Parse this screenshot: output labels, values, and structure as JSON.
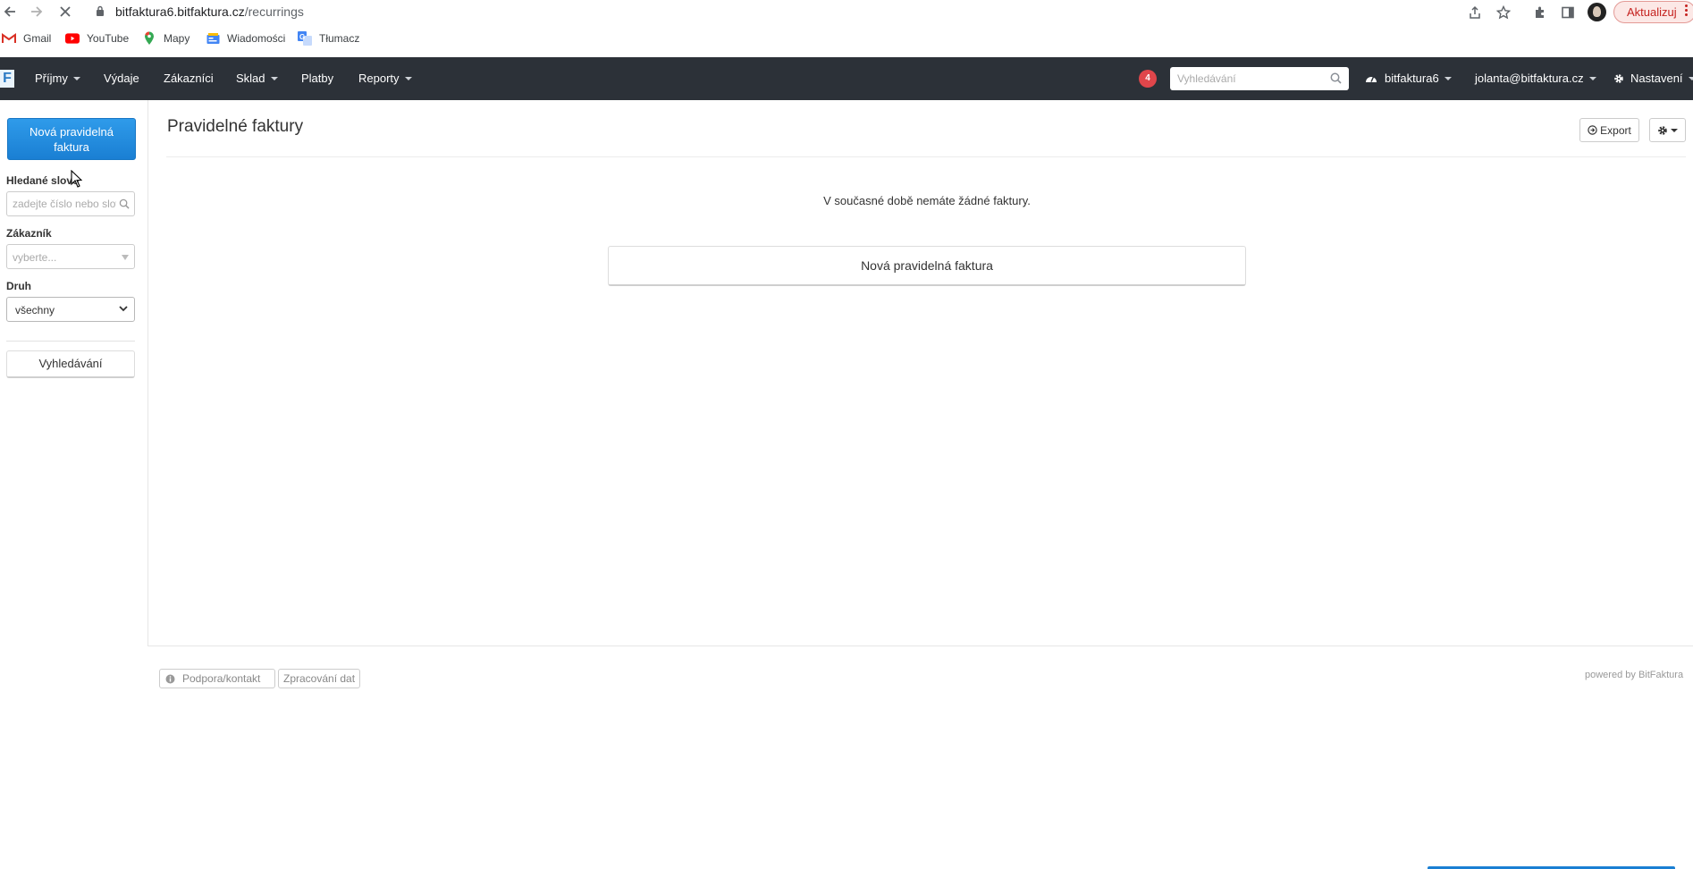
{
  "browser": {
    "url_host": "bitfaktura6.bitfaktura.cz",
    "url_path": "/recurrings",
    "update_label": "Aktualizuj",
    "bookmarks": [
      {
        "label": "Gmail",
        "icon": "gmail-icon"
      },
      {
        "label": "YouTube",
        "icon": "youtube-icon"
      },
      {
        "label": "Mapy",
        "icon": "maps-icon"
      },
      {
        "label": "Wiadomości",
        "icon": "news-icon"
      },
      {
        "label": "Tłumacz",
        "icon": "translate-icon"
      }
    ]
  },
  "navbar": {
    "brand": "F",
    "items": [
      {
        "label": "Příjmy",
        "dropdown": true
      },
      {
        "label": "Výdaje",
        "dropdown": false
      },
      {
        "label": "Zákazníci",
        "dropdown": false
      },
      {
        "label": "Sklad",
        "dropdown": true
      },
      {
        "label": "Platby",
        "dropdown": false
      },
      {
        "label": "Reporty",
        "dropdown": true
      }
    ],
    "notification_count": "4",
    "search_placeholder": "Vyhledávání",
    "account": "bitfaktura6",
    "user": "jolanta@bitfaktura.cz",
    "settings": "Nastavení"
  },
  "sidebar": {
    "new_button": "Nová pravidelná faktura",
    "search_label": "Hledané slovo",
    "search_placeholder": "zadejte číslo nebo slovo",
    "customer_label": "Zákazník",
    "customer_placeholder": "vyberte...",
    "kind_label": "Druh",
    "kind_value": "všechny",
    "search_button": "Vyhledávání"
  },
  "main": {
    "title": "Pravidelné faktury",
    "export_label": "Export",
    "empty_message": "V současné době nemáte žádné faktury.",
    "new_button": "Nová pravidelná faktura"
  },
  "footer": {
    "support": "Podpora/kontakt",
    "data_processing": "Zpracování dat",
    "powered_prefix": "powered by",
    "powered_brand": "BitFaktura"
  },
  "colors": {
    "navbar_bg": "#2c3138",
    "primary": "#1a7fd3",
    "badge": "#e0464b"
  }
}
